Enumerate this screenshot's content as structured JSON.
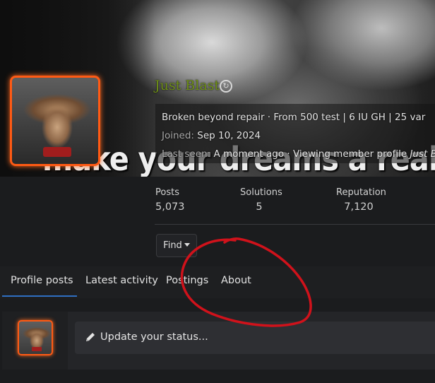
{
  "profile": {
    "banner_caption": "make your dreams a reality, re",
    "username": "Just Blast",
    "username_color": "#6e8f16",
    "avatar_border_color": "#ff5a14",
    "custom_title": "Broken beyond repair · From 500 test | 6 IU GH | 25 var",
    "joined_label": "Joined:",
    "joined_value": "Sep 10, 2024",
    "last_seen_label": "Last seen:",
    "last_seen_value": "A moment ago · Viewing member profile",
    "last_seen_target": "Just Bla",
    "badge_icon": "spiral-badge-icon"
  },
  "stats": [
    {
      "label": "Posts",
      "value": "5,073"
    },
    {
      "label": "Solutions",
      "value": "5"
    },
    {
      "label": "Reputation",
      "value": "7,120"
    }
  ],
  "find": {
    "label": "Find"
  },
  "tabs": [
    {
      "label": "Profile posts",
      "active": true
    },
    {
      "label": "Latest activity",
      "active": false
    },
    {
      "label": "Postings",
      "active": false
    },
    {
      "label": "About",
      "active": false
    }
  ],
  "accent_color": "#2f6fc2",
  "status": {
    "placeholder": "Update your status...",
    "icon": "pencil-icon"
  },
  "annotation": {
    "color": "#d0121b",
    "shape": "hand-drawn circle"
  }
}
